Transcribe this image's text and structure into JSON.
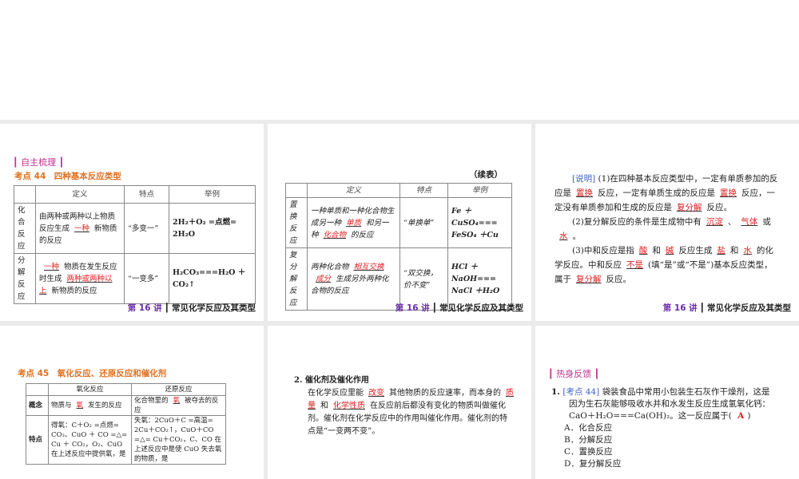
{
  "footer": {
    "lecture": "第 16 讲",
    "bar": "┃",
    "title": "常见化学反应及其类型"
  },
  "slide1": {
    "section": "┃ 自主梳理 ┃",
    "heading": "考点 44　四种基本反应类型",
    "headers": [
      "",
      "定义",
      "特点",
      "举例"
    ],
    "rows": [
      {
        "name": "化合反应",
        "def": [
          {
            "t": "由两种或两种以上物质反应生成"
          },
          {
            "b": "一种"
          },
          {
            "t": "新物质的反应"
          }
        ],
        "feature": "“多变一”",
        "example": "2H₂＋O₂ =点燃= 2H₂O"
      },
      {
        "name": "分解反应",
        "def": [
          {
            "b": "一种"
          },
          {
            "t": "物质在发生反应时生成"
          },
          {
            "b": "两种或两种以上"
          },
          {
            "t": "新物质的反应"
          }
        ],
        "feature": "“一变多”",
        "example": "H₂CO₃===H₂O ＋ CO₂↑"
      }
    ]
  },
  "slide2": {
    "cont": "（续表）",
    "headers": [
      "",
      "定义",
      "特点",
      "举例"
    ],
    "rows": [
      {
        "name": "置换反应",
        "def": [
          {
            "t": "一种单质和一种化合物生成另一种"
          },
          {
            "b": "单质"
          },
          {
            "t": "和另一种"
          },
          {
            "b": "化合物"
          },
          {
            "t": "的反应"
          }
        ],
        "feature": "“单换单”",
        "example": "Fe ＋ CuSO₄=== FeSO₄ ＋Cu"
      },
      {
        "name": "复分解反应",
        "def": [
          {
            "t": "两种化合物"
          },
          {
            "b": "相互交换"
          },
          {
            "b": "成分"
          },
          {
            "t": "生成另外两种化合物的反应"
          }
        ],
        "feature": "“双交换，价不变”",
        "example": "HCl ＋ NaOH=== NaCl ＋H₂O"
      }
    ]
  },
  "slide3": {
    "paragraphs": [
      [
        {
          "tag": "[说明]"
        },
        {
          "t": " (1)在四种基本反应类型中，一定有单质参加的反应是"
        },
        {
          "b": "置换"
        },
        {
          "t": "反应，一定有单质生成的反应是"
        },
        {
          "b": "置换"
        },
        {
          "t": "反应，一定没有单质参加和生成的反应是"
        },
        {
          "b": "复分解"
        },
        {
          "t": "反应。"
        }
      ],
      [
        {
          "t": "(2)复分解反应的条件是生成物中有"
        },
        {
          "b": "沉淀"
        },
        {
          "t": "、"
        },
        {
          "b": "气体"
        },
        {
          "t": "或"
        },
        {
          "b": "水"
        },
        {
          "t": "。"
        }
      ],
      [
        {
          "t": "(3)中和反应是指"
        },
        {
          "b": "酸"
        },
        {
          "t": "和"
        },
        {
          "b": "碱"
        },
        {
          "t": "反应生成"
        },
        {
          "b": "盐"
        },
        {
          "t": "和"
        },
        {
          "b": "水"
        },
        {
          "t": "的化学反应。中和反应"
        },
        {
          "b": "不是"
        },
        {
          "t": "(填“是”或“不是”)基本反应类型，属于"
        },
        {
          "b": "复分解"
        },
        {
          "t": "反应。"
        }
      ]
    ]
  },
  "slide4": {
    "heading": "考点 45　氧化反应、还原反应和催化剂",
    "headers": [
      "",
      "氧化反应",
      "还原反应"
    ],
    "concept": {
      "label": "概念",
      "ox": [
        {
          "t": "物质与"
        },
        {
          "b": "氧"
        },
        {
          "t": "发生的反应"
        }
      ],
      "red": [
        {
          "t": "化合物里的"
        },
        {
          "b": "氧"
        },
        {
          "t": "被夺去的反应"
        }
      ]
    },
    "feature": {
      "label": "特点",
      "ox": "得氧：C＋O₂ =点燃= CO₂、CuO ＋ CO =△= Cu ＋ CO₂，O₂、CuO 在上述反应中提供氧，是",
      "red": "失氧：2CuO＋C =高温= 2Cu＋CO₂↑，CuO＋CO =△= Cu＋CO₂，C、CO 在上述反应中是使 CuO 失去氧的物质，是"
    }
  },
  "slide5": {
    "title": "2. 催化剂及催化作用",
    "body": [
      {
        "t": "在化学反应里能"
      },
      {
        "b": "改变"
      },
      {
        "t": "其他物质的反应速率，而本身的"
      },
      {
        "b": "质量"
      },
      {
        "t": "和"
      },
      {
        "b": "化学性质"
      },
      {
        "t": "在反应前后都没有变化的物质叫做催化剂。催化剂在化学反应中的作用叫催化作用。催化剂的特点是“一变两不变”。"
      }
    ]
  },
  "slide6": {
    "section": "┃ 热身反馈 ┃",
    "number": "1.",
    "tag": "[考点 44]",
    "stem": "袋装食品中常用小包装生石灰作干燥剂，这是因为生石灰能够吸收水并和水发生反应生成氢氧化钙：CaO＋H₂O===Ca(OH)₂。这一反应属于(",
    "answer": "A",
    "close": ")",
    "options": [
      "A．化合反应",
      "B．分解反应",
      "C．置换反应",
      "D．复分解反应"
    ]
  }
}
